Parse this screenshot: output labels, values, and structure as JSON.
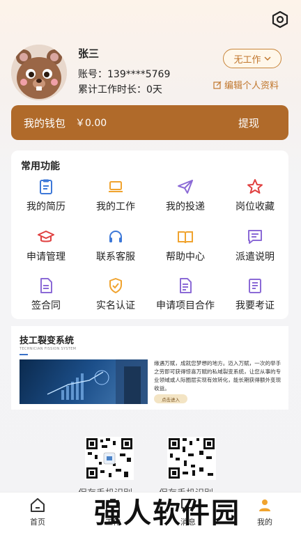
{
  "profile": {
    "name": "张三",
    "account": "账号：139****5769",
    "work_time": "累计工作时长：0天",
    "status": "无工作",
    "edit": "编辑个人资料"
  },
  "wallet": {
    "label": "我的钱包",
    "amount": "￥0.00",
    "withdraw": "提现"
  },
  "functions": {
    "title": "常用功能",
    "items": [
      {
        "label": "我的简历",
        "icon": "resume-icon"
      },
      {
        "label": "我的工作",
        "icon": "laptop-icon"
      },
      {
        "label": "我的投递",
        "icon": "paper-plane-icon"
      },
      {
        "label": "岗位收藏",
        "icon": "star-icon"
      },
      {
        "label": "申请管理",
        "icon": "graduation-cap-icon"
      },
      {
        "label": "联系客服",
        "icon": "headset-icon"
      },
      {
        "label": "帮助中心",
        "icon": "book-icon"
      },
      {
        "label": "派遣说明",
        "icon": "message-icon"
      },
      {
        "label": "签合同",
        "icon": "document-icon"
      },
      {
        "label": "实名认证",
        "icon": "shield-check-icon"
      },
      {
        "label": "申请项目合作",
        "icon": "document-list-icon"
      },
      {
        "label": "我要考证",
        "icon": "certificate-icon"
      }
    ]
  },
  "promo": {
    "title": "技工裂变系统",
    "subtitle": "TECHNICIAN FISSION SYSTEM",
    "text": "缘遇万赋，成就您梦想的地方。迈入万赋，一次的举手之劳即可获得惊喜万赋的私域裂变系统，让您从事的专业领域或人际圈层实现有效转化，能长期获得额外变现收益。",
    "button": "点击进入"
  },
  "qr_captions": [
    "保存手机识别",
    "保存手机识别"
  ],
  "tabs": [
    {
      "label": "首页",
      "icon": "home-icon"
    },
    {
      "label": "工作",
      "icon": "briefcase-icon"
    },
    {
      "label": "消息",
      "icon": "chat-icon"
    },
    {
      "label": "我的",
      "icon": "user-icon"
    }
  ],
  "watermark": "强人软件园",
  "colors": {
    "accent": "#b06a2a",
    "icon_blue": "#3d78d8",
    "icon_orange": "#f0a32e",
    "icon_purple": "#8b6ad6",
    "icon_red": "#e04040"
  }
}
